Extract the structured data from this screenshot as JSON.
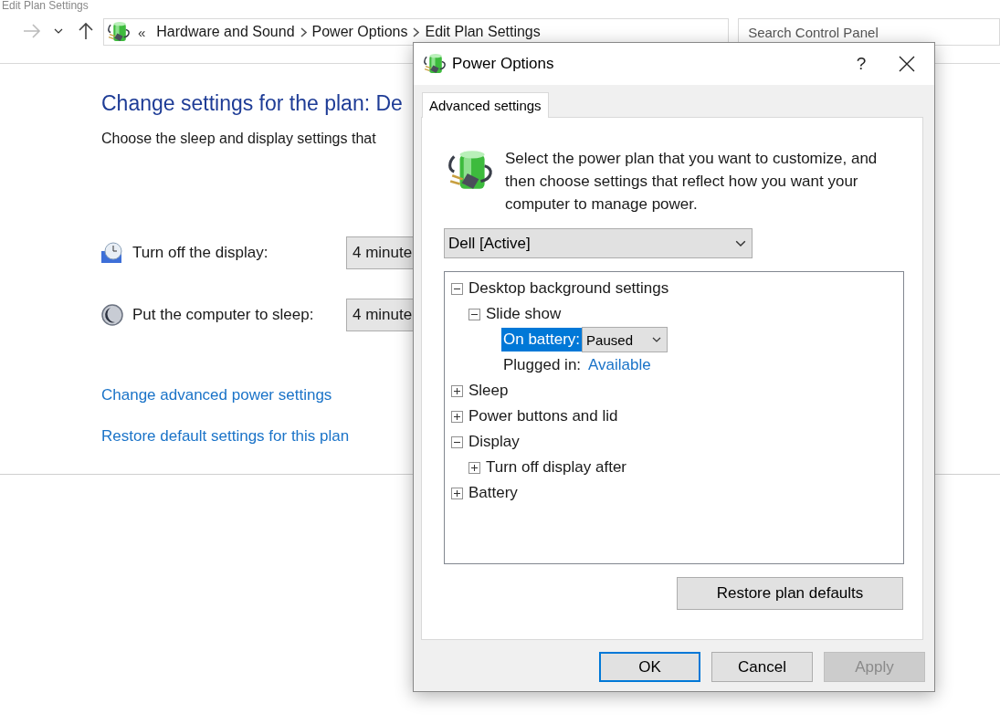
{
  "background_window": {
    "title": "Edit Plan Settings",
    "breadcrumb_prefix": "«",
    "breadcrumb": [
      "Hardware and Sound",
      "Power Options",
      "Edit Plan Settings"
    ],
    "search": {
      "placeholder": "Search Control Panel"
    },
    "heading": "Change settings for the plan: De",
    "subtitle": "Choose the sleep and display settings that",
    "settings": [
      {
        "kind": "display",
        "label": "Turn off the display:",
        "value": "4 minute"
      },
      {
        "kind": "sleep",
        "label": "Put the computer to sleep:",
        "value": "4 minute"
      }
    ],
    "links": [
      "Change advanced power settings",
      "Restore default settings for this plan"
    ]
  },
  "dialog": {
    "title": "Power Options",
    "help": "?",
    "tabs": [
      {
        "label": "Advanced settings",
        "selected": true
      }
    ],
    "description": "Select the power plan that you want to customize, and then choose settings that reflect how you want your computer to manage power.",
    "plan": "Dell [Active]",
    "tree": [
      {
        "kind": "group",
        "label": "Desktop background settings",
        "expanded": true,
        "children": [
          {
            "kind": "group",
            "label": "Slide show",
            "expanded": true,
            "children": [
              {
                "kind": "setting",
                "label": "On battery:",
                "value": "Paused",
                "selected": true
              },
              {
                "kind": "setting",
                "label": "Plugged in:",
                "value": "Available",
                "selected": false
              }
            ]
          }
        ]
      },
      {
        "kind": "group",
        "label": "Sleep",
        "expanded": false
      },
      {
        "kind": "group",
        "label": "Power buttons and lid",
        "expanded": false
      },
      {
        "kind": "group",
        "label": "Display",
        "expanded": true,
        "children": [
          {
            "kind": "group",
            "label": "Turn off display after",
            "expanded": false
          }
        ]
      },
      {
        "kind": "group",
        "label": "Battery",
        "expanded": false
      }
    ],
    "restore_button": "Restore plan defaults",
    "buttons": [
      {
        "label": "OK",
        "default": true,
        "disabled": false
      },
      {
        "label": "Cancel",
        "default": false,
        "disabled": false
      },
      {
        "label": "Apply",
        "default": false,
        "disabled": true
      }
    ]
  }
}
